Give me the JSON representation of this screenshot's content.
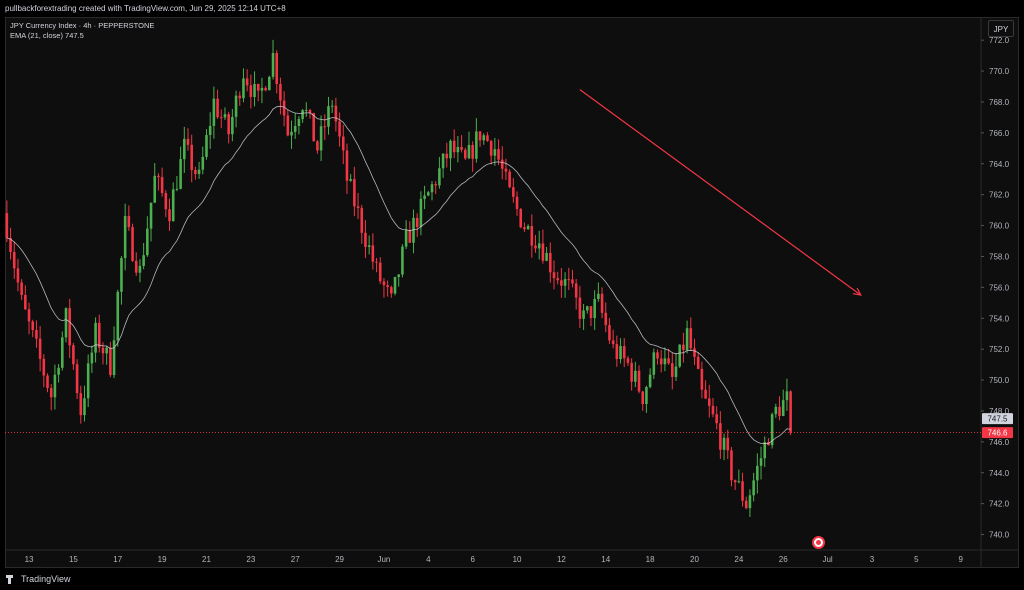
{
  "header": {
    "caption": "pullbackforextrading created with TradingView.com, Jun 29, 2025 12:14 UTC+8"
  },
  "legend": {
    "symbol_line": "JPY Currency Index · 4h · PEPPERSTONE",
    "ema_line": "EMA (21, close)  747.5"
  },
  "currency_button": "JPY",
  "footer": {
    "brand": "TradingView"
  },
  "colors": {
    "up": "#26a69a",
    "up_body": "#4caf50",
    "down": "#f23645",
    "ema": "#d1d4dc",
    "grid": "#1c1c1c",
    "trend": "#f23645",
    "bg": "#0e0e0e"
  },
  "chart_data": {
    "type": "candlestick",
    "title": "JPY Currency Index · 4h · PEPPERSTONE",
    "ylim": [
      739,
      773.5
    ],
    "y_ticks": [
      740,
      742,
      744,
      746,
      748,
      750,
      752,
      754,
      756,
      758,
      760,
      762,
      764,
      766,
      768,
      770,
      772
    ],
    "y_tick_labels": [
      "740.0",
      "742.0",
      "744.0",
      "746.0",
      "748.0",
      "750.0",
      "752.0",
      "754.0",
      "756.0",
      "758.0",
      "760.0",
      "762.0",
      "764.0",
      "766.0",
      "768.0",
      "770.0",
      "772.0"
    ],
    "x_ticks": [
      "13",
      "15",
      "17",
      "19",
      "21",
      "23",
      "27",
      "29",
      "Jun",
      "4",
      "6",
      "10",
      "12",
      "14",
      "18",
      "20",
      "24",
      "26",
      "Jul",
      "3",
      "5",
      "9"
    ],
    "x_tick_bars": [
      6,
      18,
      30,
      42,
      54,
      66,
      78,
      90,
      102,
      114,
      126,
      138,
      150,
      162,
      174,
      186,
      198,
      210,
      222,
      234,
      246,
      258
    ],
    "x_span_bars": 264,
    "ema_label": {
      "value": 747.5,
      "text": "747.5"
    },
    "price_label": {
      "value": 746.6,
      "text": "746.6"
    },
    "trend_line": {
      "from": {
        "bar": 155,
        "value": 768.8
      },
      "to": {
        "bar": 231,
        "value": 755.5
      }
    },
    "path": [
      760,
      755,
      752,
      749,
      754,
      748,
      753,
      751,
      760,
      757,
      763,
      761,
      765,
      763,
      768,
      766,
      770,
      768,
      771,
      766,
      768,
      765,
      768,
      763,
      760,
      757,
      755,
      759,
      761,
      763,
      765,
      764,
      766,
      765,
      762,
      760,
      759,
      757,
      756,
      754,
      755,
      752,
      751,
      749,
      752,
      750,
      753,
      749,
      747,
      744,
      742,
      745,
      748,
      749,
      749.5,
      748,
      748.5,
      747,
      746.6
    ],
    "points_per_leg": 4,
    "n_candles": 213,
    "ema": {
      "period": 21,
      "source": "close",
      "last": 747.5
    }
  }
}
